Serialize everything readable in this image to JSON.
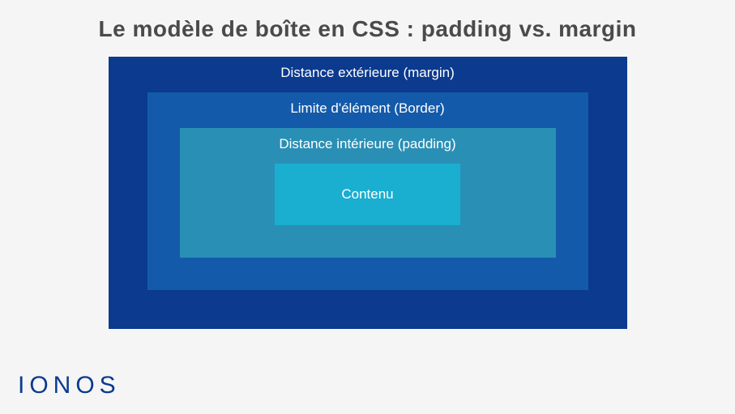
{
  "title": "Le modèle de boîte en CSS : padding vs. margin",
  "boxes": {
    "margin": "Distance extérieure (margin)",
    "border": "Limite d'élément (Border)",
    "padding": "Distance intérieure (padding)",
    "content": "Contenu"
  },
  "logo": "IONOS",
  "colors": {
    "margin": "#0b3a8f",
    "border": "#145aaa",
    "padding": "#2a8fb5",
    "content": "#1aaed1"
  }
}
